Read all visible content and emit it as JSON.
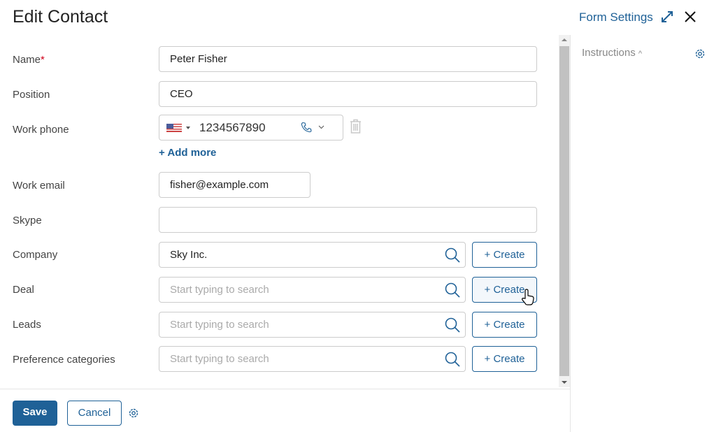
{
  "header": {
    "title": "Edit Contact",
    "form_settings": "Form Settings"
  },
  "side": {
    "instructions": "Instructions"
  },
  "fields": {
    "name": {
      "label": "Name",
      "required": "*",
      "value": "Peter Fisher"
    },
    "position": {
      "label": "Position",
      "value": "CEO"
    },
    "phone": {
      "label": "Work phone",
      "value": "1234567890",
      "add_more": "+ Add more"
    },
    "email": {
      "label": "Work email",
      "value": "fisher@example.com"
    },
    "skype": {
      "label": "Skype",
      "value": ""
    },
    "company": {
      "label": "Company",
      "value": "Sky Inc."
    },
    "deal": {
      "label": "Deal",
      "placeholder": "Start typing to search"
    },
    "leads": {
      "label": "Leads",
      "placeholder": "Start typing to search"
    },
    "pref": {
      "label": "Preference categories",
      "placeholder": "Start typing to search"
    }
  },
  "create_label": "+ Create",
  "footer": {
    "save": "Save",
    "cancel": "Cancel"
  },
  "colors": {
    "accent": "#1f6197"
  }
}
